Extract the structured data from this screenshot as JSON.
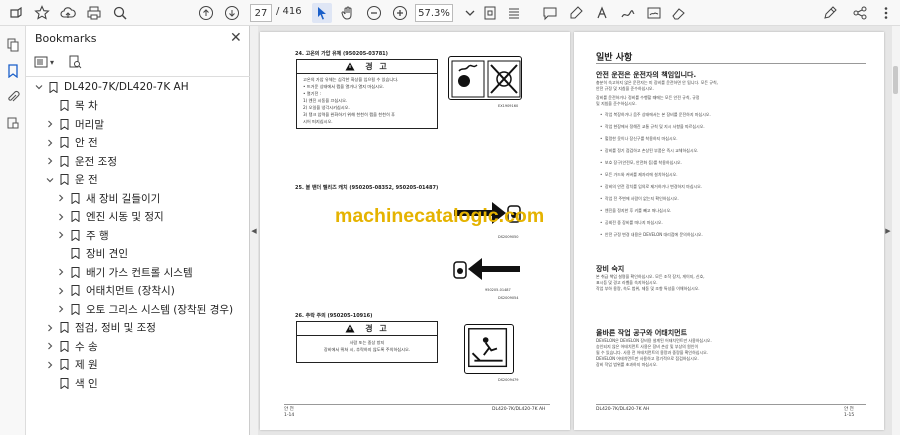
{
  "toolbar": {
    "current_page": "27",
    "page_total": "/ 416",
    "zoom": "57.3%"
  },
  "bookmarks_panel": {
    "title": "Bookmarks",
    "items": [
      {
        "label": "DL420-7K/DL420-7K AH",
        "level": 0,
        "expand": "down"
      },
      {
        "label": "목 차",
        "level": 1,
        "expand": "none"
      },
      {
        "label": "머리말",
        "level": 1,
        "expand": "right"
      },
      {
        "label": "안 전",
        "level": 1,
        "expand": "right"
      },
      {
        "label": "운전 조정",
        "level": 1,
        "expand": "right"
      },
      {
        "label": "운 전",
        "level": 1,
        "expand": "down"
      },
      {
        "label": "새 장비 길들이기",
        "level": 2,
        "expand": "right"
      },
      {
        "label": "엔진 시동 및 정지",
        "level": 2,
        "expand": "right"
      },
      {
        "label": "주 행",
        "level": 2,
        "expand": "right"
      },
      {
        "label": "장비 견인",
        "level": 2,
        "expand": "none"
      },
      {
        "label": "배기 가스 컨트롤 시스템",
        "level": 2,
        "expand": "right"
      },
      {
        "label": "어태치먼트 (장착시)",
        "level": 2,
        "expand": "right"
      },
      {
        "label": "오토 그리스 시스템 (장착된 경우)",
        "level": 2,
        "expand": "right"
      },
      {
        "label": "점검, 정비 및 조정",
        "level": 1,
        "expand": "right"
      },
      {
        "label": "수 송",
        "level": 1,
        "expand": "right"
      },
      {
        "label": "제 원",
        "level": 1,
        "expand": "right"
      },
      {
        "label": "색 인",
        "level": 1,
        "expand": "none"
      }
    ]
  },
  "watermark": "machinecatalogic.com",
  "left_page": {
    "s24_title": "24.   고온의 가압 유체 (950205-03781)",
    "s24_warn_head": "경 고",
    "s24_lines": [
      "고온의 가압 유체는 심각한 화상을 입으킬 수 있습니다.",
      "•   뜨거운 상태에서 캡을 열거나 열지 마십시오.",
      "•   열기전 :",
      "1)     엔진 시동을 끄십시오.",
      "2)     오일을 냉각시키십시오.",
      "3)     탱크 압력을 완화하기 위해 천천히 캡을 천천히 푸",
      "        시어 떠지십시오."
    ],
    "s24_code": "EX1909160",
    "s25_title": "25.   볼 밴더 텔리즈 캐치 (950205-08352, 950205-01487)",
    "s25_code_a": "DS2009050",
    "s25_code_b": "950205-01487",
    "s25_code_c": "DS2009054",
    "s26_title": "26.   추락 주의 (950205-10916)",
    "s26_warn_head": "경 고",
    "s26_lines": [
      "사람 또는 중상 방지",
      "장비에서 뛰쳐 시, 추락하지 않도록 주의하십시오."
    ],
    "s26_code": "DS2009479",
    "footer_left_a": "안 전",
    "footer_left_b": "1-14",
    "footer_right": "DL420-7K/DL420-7K AH"
  },
  "right_page": {
    "h1": "일반 사항",
    "h2_a": "안전 운전은 운전자의 책임입니다.",
    "para_a": [
      "충분히 숙고하지 않은 운전자는 미 장비를 운전하면 안 됩니다. 모든 규칙,",
      "안전 규정 및 지침을 준수하십시오.",
      "장비를 운전하거나 정비를 수행할 때에는 모든 안전 규칙, 규정",
      "및 지침을 준수하십시오."
    ],
    "bullets": [
      "작업 복장하거나 음주 상태에서는 본 장비를 운전하지 마십시오.",
      "작업 현장에서 정해진 교통 규칙 및 지시 사항을 따르십시오.",
      "헐렁한 옷이나 장신구를 착용하지 마십시오.",
      "장비를 정기 점검하고 손상된 부품은 즉시 교체하십시오.",
      "보호 장구(안전모, 안전화 등)를 착용하십시오.",
      "모든 가드와 커버를 제자리에 설치하십시오.",
      "장비의 안전 장치를 임의로 제거하거나 변경하지 마십시오.",
      "작업 전 주변에 사람이 없는지 확인하십시오.",
      "엔진을 정지한 후 키를 빼고 떠나십시오.",
      "공회전 중 장비를 떠나지 마십시오.",
      "안전 규정 변경 내용은 DEVELON 대리점에 문의하십시오."
    ],
    "h2_b": "장비 숙지",
    "para_b": [
      "본 취급 책임 설명을 확인하십시오. 모든 조작 장치, 게이지, 신호,",
      "표시등 및 경고 라벨을 숙지하십시오.",
      "작업 부하 용량, 속도 범위, 제동 및 조향 특성을 이해하십시오."
    ],
    "h2_c": "올바른 작업 공구와 어태치먼트",
    "para_c": [
      "DEVELON은 DEVELON 장비용 설계된 어태치먼트만 사용하십시오.",
      "승인되지 않은 어태치먼트 사용은 장비 손상 및 부상의 원인이",
      "될 수 있습니다. 사용 전 어태치먼트의 용량과 중량을 확인하십시오.",
      "DEVELON 어태치먼트만 사용하고 정기적으로 점검하십시오.",
      "장비 작업 범위를 초과하지 마십시오."
    ],
    "footer_left": "DL420-7K/DL420-7K AH",
    "footer_right_a": "안 전",
    "footer_right_b": "1-15"
  }
}
